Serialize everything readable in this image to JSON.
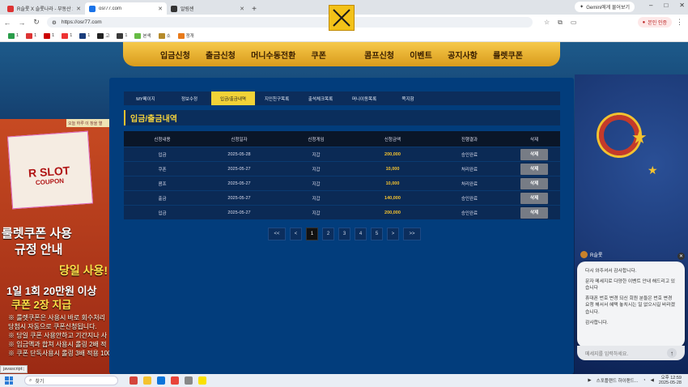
{
  "browser": {
    "tabs": [
      {
        "label": "R슬롯 X 슬롯나라 - 부동산 2차 ...",
        "active": false
      },
      {
        "label": "osr77.com",
        "active": true
      },
      {
        "label": "알림센",
        "active": false
      }
    ],
    "gemini_label": "Gemini에게 물어보기",
    "url": "https://osr77.com",
    "profile_label": "본인 인증",
    "bookmarks": [
      "1",
      "1",
      "1",
      "1",
      "1",
      "고",
      "1",
      "본색",
      "소",
      "정개"
    ]
  },
  "site": {
    "topnav": [
      "입금신청",
      "출금신청",
      "머니수동전환",
      "쿠폰",
      "콤프신청",
      "이벤트",
      "공지사항",
      "룰렛쿠폰"
    ],
    "left_banner": {
      "note": "오늘 하루 이 창을 열",
      "coupon_title": "R SLOT",
      "coupon_sub": "COUPON",
      "line1": "룰렛쿠폰 사용",
      "line2": "규정 안내",
      "line3": "당일 사용!",
      "line4": "1일 1회 20만원 이상",
      "line5": "쿠폰 2장 지급",
      "line6": "※ 룰렛쿠폰은 사용시 바로 회수처리",
      "line7": "당첨시 자동으로 쿠폰신청됩니다.",
      "line8": "※ 당일 쿠폰 사용안하고 기간지나 사",
      "line9": "※ 입금액과 합쳐 사용시 롤링 2배 적",
      "line10": "※ 쿠폰 단독사용시 롤링 3배 적용 100"
    },
    "panel": {
      "subtabs": [
        "MY페이지",
        "정보수정",
        "입금/출금내역",
        "지인친구목록",
        "출석체크목록",
        "머니이동목록",
        "쪽지함"
      ],
      "active_subtab": 2,
      "section_title": "입금/출금내역",
      "table": {
        "headers": [
          "신청내용",
          "신청일자",
          "신청게임",
          "신청금액",
          "진행결과",
          "삭제"
        ],
        "rows": [
          {
            "type": "입금",
            "date": "2025-05-28",
            "game": "지갑",
            "amount": "200,000",
            "result": "승인완료",
            "action": "삭제"
          },
          {
            "type": "쿠폰",
            "date": "2025-05-27",
            "game": "지갑",
            "amount": "10,000",
            "result": "처리완료",
            "action": "삭제"
          },
          {
            "type": "콤프",
            "date": "2025-05-27",
            "game": "지갑",
            "amount": "10,000",
            "result": "처리완료",
            "action": "삭제"
          },
          {
            "type": "출금",
            "date": "2025-05-27",
            "game": "지갑",
            "amount": "140,000",
            "result": "승인완료",
            "action": "삭제"
          },
          {
            "type": "입금",
            "date": "2025-05-27",
            "game": "지갑",
            "amount": "200,000",
            "result": "승인완료",
            "action": "삭제"
          }
        ]
      },
      "pager": [
        "<<",
        "<",
        "1",
        "2",
        "3",
        "4",
        "5",
        ">",
        ">>"
      ],
      "current_page": "1"
    },
    "chat": {
      "agent": "R슬롯",
      "messages": [
        "다시 와주셔서 감사합니다.",
        "문자 메세지로 다양한 이벤트 안내 해드리고 있습니다",
        "휴대폰 번호 변경 되신 회원 분들은 번호 변경 요청 해서서 혜택 놓치시는 일 없으시길 바라겠습니다.",
        "감사합니다."
      ],
      "input_placeholder": "메세지를 입력하세요."
    },
    "status_tip": "javascript:;"
  },
  "taskbar": {
    "search_label": "찾기",
    "tray_text": "스포플랜드 하이랜드...",
    "time": "오후 12:59",
    "date": "2025-05-28"
  },
  "colors": {
    "accent_gold": "#f4c22f",
    "panel_blue": "#023d7c",
    "delete_button": "#777c85"
  }
}
